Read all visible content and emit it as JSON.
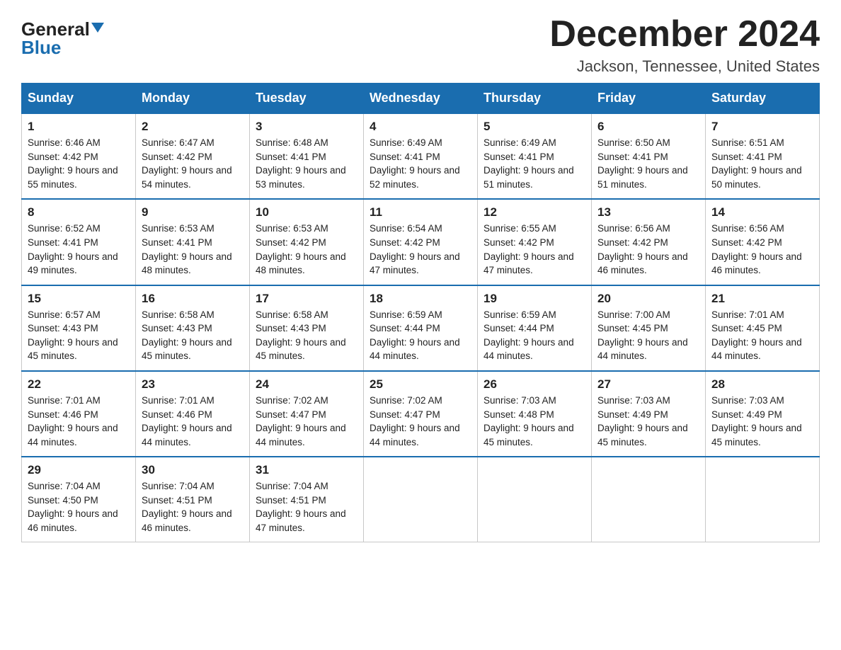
{
  "header": {
    "logo_general": "General",
    "logo_blue": "Blue",
    "month_title": "December 2024",
    "location": "Jackson, Tennessee, United States"
  },
  "weekdays": [
    "Sunday",
    "Monday",
    "Tuesday",
    "Wednesday",
    "Thursday",
    "Friday",
    "Saturday"
  ],
  "weeks": [
    [
      {
        "day": "1",
        "sunrise": "Sunrise: 6:46 AM",
        "sunset": "Sunset: 4:42 PM",
        "daylight": "Daylight: 9 hours and 55 minutes."
      },
      {
        "day": "2",
        "sunrise": "Sunrise: 6:47 AM",
        "sunset": "Sunset: 4:42 PM",
        "daylight": "Daylight: 9 hours and 54 minutes."
      },
      {
        "day": "3",
        "sunrise": "Sunrise: 6:48 AM",
        "sunset": "Sunset: 4:41 PM",
        "daylight": "Daylight: 9 hours and 53 minutes."
      },
      {
        "day": "4",
        "sunrise": "Sunrise: 6:49 AM",
        "sunset": "Sunset: 4:41 PM",
        "daylight": "Daylight: 9 hours and 52 minutes."
      },
      {
        "day": "5",
        "sunrise": "Sunrise: 6:49 AM",
        "sunset": "Sunset: 4:41 PM",
        "daylight": "Daylight: 9 hours and 51 minutes."
      },
      {
        "day": "6",
        "sunrise": "Sunrise: 6:50 AM",
        "sunset": "Sunset: 4:41 PM",
        "daylight": "Daylight: 9 hours and 51 minutes."
      },
      {
        "day": "7",
        "sunrise": "Sunrise: 6:51 AM",
        "sunset": "Sunset: 4:41 PM",
        "daylight": "Daylight: 9 hours and 50 minutes."
      }
    ],
    [
      {
        "day": "8",
        "sunrise": "Sunrise: 6:52 AM",
        "sunset": "Sunset: 4:41 PM",
        "daylight": "Daylight: 9 hours and 49 minutes."
      },
      {
        "day": "9",
        "sunrise": "Sunrise: 6:53 AM",
        "sunset": "Sunset: 4:41 PM",
        "daylight": "Daylight: 9 hours and 48 minutes."
      },
      {
        "day": "10",
        "sunrise": "Sunrise: 6:53 AM",
        "sunset": "Sunset: 4:42 PM",
        "daylight": "Daylight: 9 hours and 48 minutes."
      },
      {
        "day": "11",
        "sunrise": "Sunrise: 6:54 AM",
        "sunset": "Sunset: 4:42 PM",
        "daylight": "Daylight: 9 hours and 47 minutes."
      },
      {
        "day": "12",
        "sunrise": "Sunrise: 6:55 AM",
        "sunset": "Sunset: 4:42 PM",
        "daylight": "Daylight: 9 hours and 47 minutes."
      },
      {
        "day": "13",
        "sunrise": "Sunrise: 6:56 AM",
        "sunset": "Sunset: 4:42 PM",
        "daylight": "Daylight: 9 hours and 46 minutes."
      },
      {
        "day": "14",
        "sunrise": "Sunrise: 6:56 AM",
        "sunset": "Sunset: 4:42 PM",
        "daylight": "Daylight: 9 hours and 46 minutes."
      }
    ],
    [
      {
        "day": "15",
        "sunrise": "Sunrise: 6:57 AM",
        "sunset": "Sunset: 4:43 PM",
        "daylight": "Daylight: 9 hours and 45 minutes."
      },
      {
        "day": "16",
        "sunrise": "Sunrise: 6:58 AM",
        "sunset": "Sunset: 4:43 PM",
        "daylight": "Daylight: 9 hours and 45 minutes."
      },
      {
        "day": "17",
        "sunrise": "Sunrise: 6:58 AM",
        "sunset": "Sunset: 4:43 PM",
        "daylight": "Daylight: 9 hours and 45 minutes."
      },
      {
        "day": "18",
        "sunrise": "Sunrise: 6:59 AM",
        "sunset": "Sunset: 4:44 PM",
        "daylight": "Daylight: 9 hours and 44 minutes."
      },
      {
        "day": "19",
        "sunrise": "Sunrise: 6:59 AM",
        "sunset": "Sunset: 4:44 PM",
        "daylight": "Daylight: 9 hours and 44 minutes."
      },
      {
        "day": "20",
        "sunrise": "Sunrise: 7:00 AM",
        "sunset": "Sunset: 4:45 PM",
        "daylight": "Daylight: 9 hours and 44 minutes."
      },
      {
        "day": "21",
        "sunrise": "Sunrise: 7:01 AM",
        "sunset": "Sunset: 4:45 PM",
        "daylight": "Daylight: 9 hours and 44 minutes."
      }
    ],
    [
      {
        "day": "22",
        "sunrise": "Sunrise: 7:01 AM",
        "sunset": "Sunset: 4:46 PM",
        "daylight": "Daylight: 9 hours and 44 minutes."
      },
      {
        "day": "23",
        "sunrise": "Sunrise: 7:01 AM",
        "sunset": "Sunset: 4:46 PM",
        "daylight": "Daylight: 9 hours and 44 minutes."
      },
      {
        "day": "24",
        "sunrise": "Sunrise: 7:02 AM",
        "sunset": "Sunset: 4:47 PM",
        "daylight": "Daylight: 9 hours and 44 minutes."
      },
      {
        "day": "25",
        "sunrise": "Sunrise: 7:02 AM",
        "sunset": "Sunset: 4:47 PM",
        "daylight": "Daylight: 9 hours and 44 minutes."
      },
      {
        "day": "26",
        "sunrise": "Sunrise: 7:03 AM",
        "sunset": "Sunset: 4:48 PM",
        "daylight": "Daylight: 9 hours and 45 minutes."
      },
      {
        "day": "27",
        "sunrise": "Sunrise: 7:03 AM",
        "sunset": "Sunset: 4:49 PM",
        "daylight": "Daylight: 9 hours and 45 minutes."
      },
      {
        "day": "28",
        "sunrise": "Sunrise: 7:03 AM",
        "sunset": "Sunset: 4:49 PM",
        "daylight": "Daylight: 9 hours and 45 minutes."
      }
    ],
    [
      {
        "day": "29",
        "sunrise": "Sunrise: 7:04 AM",
        "sunset": "Sunset: 4:50 PM",
        "daylight": "Daylight: 9 hours and 46 minutes."
      },
      {
        "day": "30",
        "sunrise": "Sunrise: 7:04 AM",
        "sunset": "Sunset: 4:51 PM",
        "daylight": "Daylight: 9 hours and 46 minutes."
      },
      {
        "day": "31",
        "sunrise": "Sunrise: 7:04 AM",
        "sunset": "Sunset: 4:51 PM",
        "daylight": "Daylight: 9 hours and 47 minutes."
      },
      null,
      null,
      null,
      null
    ]
  ]
}
